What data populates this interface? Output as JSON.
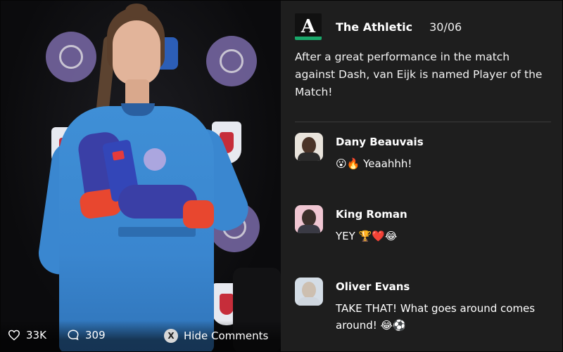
{
  "media": {
    "likes": "33K",
    "comments_count": "309",
    "hide_comments_button": "X",
    "hide_comments_label": "Hide Comments"
  },
  "post": {
    "source": "The Athletic",
    "logo_letter": "A",
    "date": "30/06",
    "text": "After a great performance in the match against Dash, van Eijk is named Player of the Match!",
    "accent_color": "#1aa86b"
  },
  "comments": [
    {
      "name": "Dany Beauvais",
      "message": "😮🔥 Yeaahhh!"
    },
    {
      "name": "King Roman",
      "message": "YEY 🏆❤️😂"
    },
    {
      "name": "Oliver Evans",
      "message": "TAKE THAT! What goes around comes around! 😂⚽"
    }
  ],
  "icons": {
    "likes": "heart-icon",
    "comments": "speech-bubble-icon",
    "hide": "x-button-icon"
  }
}
